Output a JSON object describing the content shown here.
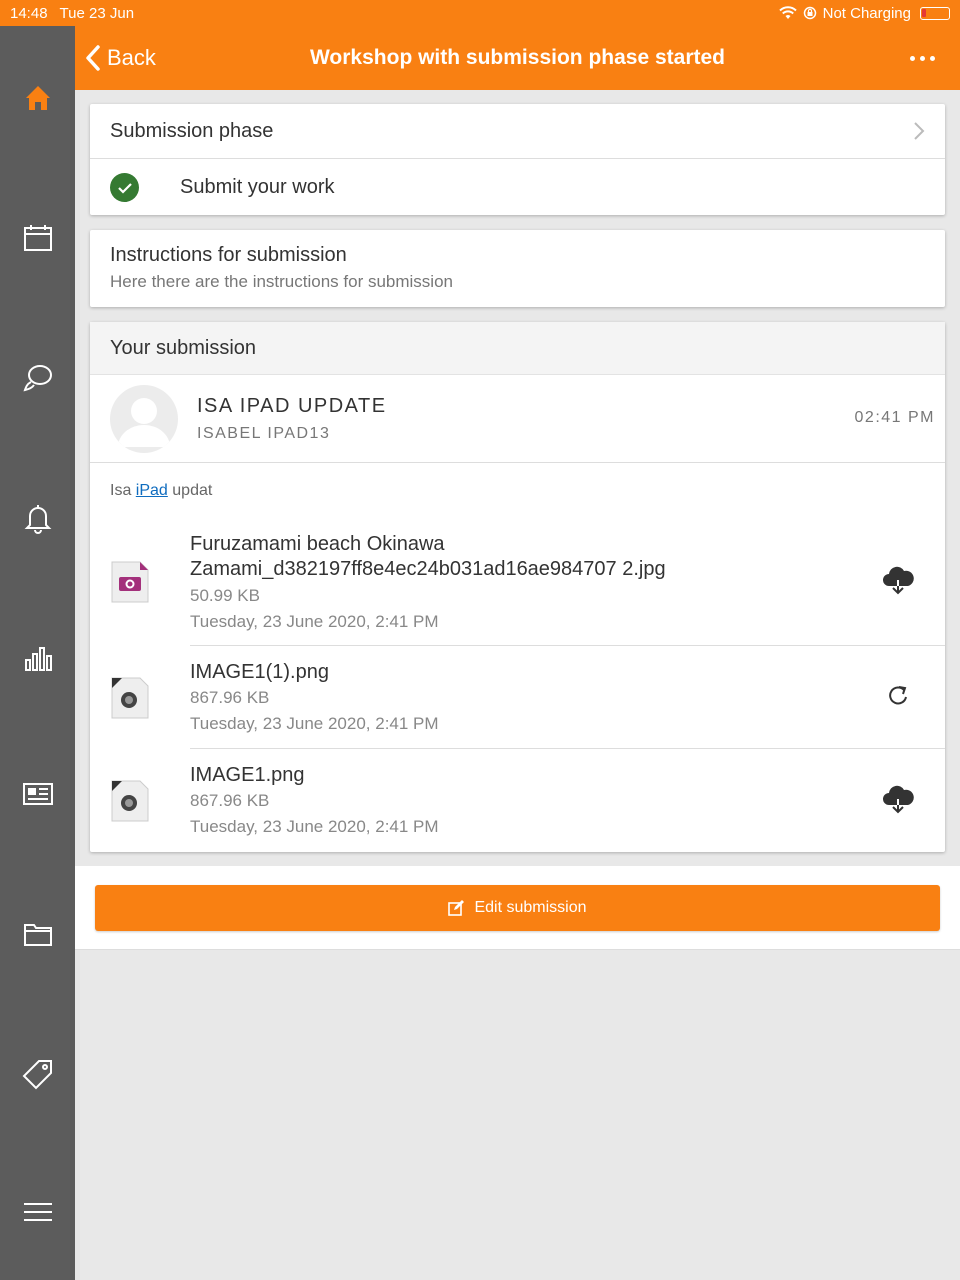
{
  "status_bar": {
    "time": "14:48",
    "date": "Tue 23 Jun",
    "charging": "Not Charging"
  },
  "nav": {
    "back_label": "Back",
    "title": "Workshop with submission phase started"
  },
  "sidebar": {
    "items": [
      {
        "icon": "home-icon",
        "active": true
      },
      {
        "icon": "calendar-icon"
      },
      {
        "icon": "messages-icon"
      },
      {
        "icon": "notifications-icon"
      },
      {
        "icon": "grades-icon"
      },
      {
        "icon": "news-icon"
      },
      {
        "icon": "files-icon"
      },
      {
        "icon": "tag-icon"
      },
      {
        "icon": "menu-icon"
      }
    ]
  },
  "phase": {
    "title": "Submission phase",
    "task": "Submit your work"
  },
  "instructions": {
    "title": "Instructions for submission",
    "text": "Here there are the instructions for submission"
  },
  "submission": {
    "header": "Your submission",
    "user_title": "ISA IPAD UPDATE",
    "user_name": "ISABEL IPAD13",
    "time": "02:41 PM",
    "message_pre": "Isa ",
    "message_link": "iPad",
    "message_post": " updat",
    "files": [
      {
        "name_line1": "Furuzamami beach Okinawa",
        "name_line2": "Zamami_d382197ff8e4ec24b031ad16ae984707 2.jpg",
        "size": "50.99 KB",
        "date": "Tuesday, 23 June 2020, 2:41 PM",
        "action": "download-icon"
      },
      {
        "name_line1": "IMAGE1(1).png",
        "size": "867.96 KB",
        "date": "Tuesday, 23 June 2020, 2:41 PM",
        "action": "refresh-icon"
      },
      {
        "name_line1": "IMAGE1.png",
        "size": "867.96 KB",
        "date": "Tuesday, 23 June 2020, 2:41 PM",
        "action": "download-icon"
      }
    ]
  },
  "edit_button": "Edit submission",
  "colors": {
    "accent": "#f98012",
    "sidebar": "#5c5c5c",
    "success": "#357a32",
    "link": "#0f6cbf"
  }
}
